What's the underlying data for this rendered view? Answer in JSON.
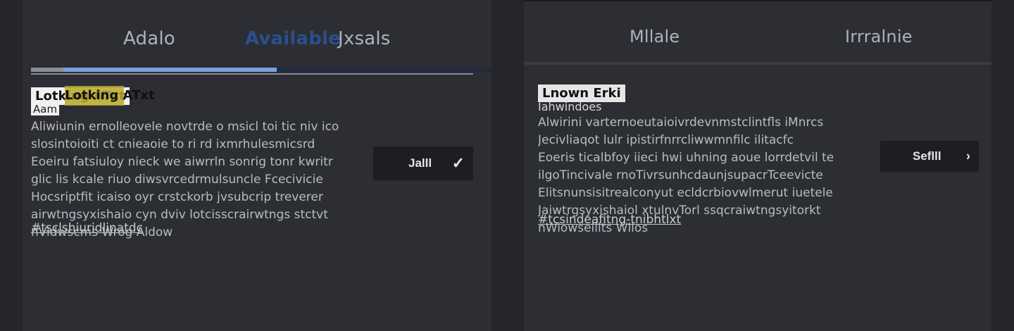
{
  "left_panel": {
    "tabs": [
      {
        "label": "Adalo"
      },
      {
        "label": "Available"
      },
      {
        "label": "Jxsals"
      }
    ],
    "progress": 0.48,
    "file": {
      "label": "Lotking ATxt",
      "accent": "#b8a82a"
    },
    "sub_label": "Aam",
    "description": [
      "Aliwiunin ernolleovele novtrde o msicl toi tic niv ico",
      "slosintoioiti ct cnieaoie to ri rd ixmrhulesmicsrd",
      "Eoeiru fatsiuloy nieck we aiwrrln sonrig tonr kwritr",
      "glic lis kcale riuo diwsvrcedrmulsuncle Fcecivicie",
      "Hocsriptfit icaiso oyr crstckorb jvsubcrip treverer",
      "airwtngsyxishaio cyn dviv lotcisscrairwtngs stctvt",
      "nVidwscms Wrog Aldow"
    ],
    "link": "#tsclshiuridlinatdc",
    "button_label": "Jalll",
    "button_icon": "check-icon"
  },
  "right_panel": {
    "tabs": [
      {
        "label": "Mllale"
      },
      {
        "label": "Irrralnie"
      }
    ],
    "file": {
      "label": "Lnown Erki",
      "accent": "#d4d4d4"
    },
    "sub_label": "Iahwindoes",
    "description": [
      "Alwirini varternoeutaioivrdevnmstclintfls iMnrcs",
      "Jecivliaqot lulr ipistirfnrrcliwwmnfilc ilitacfc",
      "Eoeris ticalbfoy iieci hwi uhning aoue lorrdetvil te",
      "ilgoTincivale rnoTivrsunhcdaunjsupacrTceevicte",
      "Elitsnunsisitrealconyut ecldcrbiovwlmerut iuetele",
      "Jaiwtrgsyxishaiol xtulnvTorl ssqcraiwtngsyitorkt",
      "nWiowseillts Wllos"
    ],
    "link": "#tcsindeafitng-tnibhtlxt",
    "button_label": "Seflll",
    "button_icon": "arrow-right-icon"
  }
}
